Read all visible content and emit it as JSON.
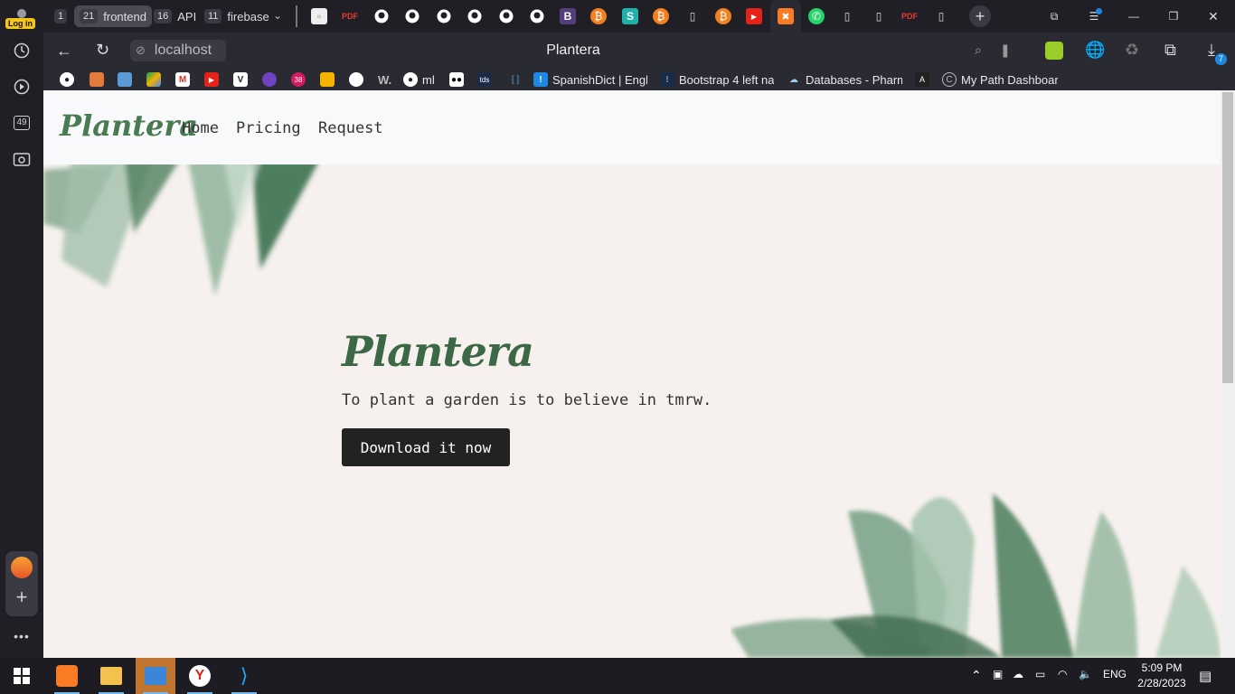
{
  "sidebar": {
    "login_label": "Log in",
    "badge_count": "49"
  },
  "tabstrip": {
    "workspaces": [
      {
        "num": "1",
        "label": ""
      },
      {
        "num": "21",
        "label": "frontend"
      },
      {
        "num": "16",
        "label": "API"
      },
      {
        "num": "11",
        "label": "firebase"
      }
    ],
    "new_tab": "+"
  },
  "addressbar": {
    "url": "localhost",
    "page_title": "Plantera",
    "downloads_badge": "7"
  },
  "bookmarks": [
    {
      "label": "ml",
      "icon": "github-icon"
    },
    {
      "label": "SpanishDict | Engli",
      "icon": "spanishdict-icon"
    },
    {
      "label": "Bootstrap 4 left na",
      "icon": "bootstrap-icon"
    },
    {
      "label": "Databases - Pharm",
      "icon": "cloud-icon"
    },
    {
      "label": "My Path Dashboar",
      "icon": "path-icon"
    }
  ],
  "bookmark_misc": {
    "youtube_badge": "38",
    "w_label": "W.",
    "tds_label": "tds"
  },
  "page": {
    "brand": "Plantera",
    "nav": [
      "Home",
      "Pricing",
      "Request"
    ],
    "hero_title": "Plantera",
    "hero_subtitle": "To plant a garden is to believe in tmrw.",
    "hero_button": "Download it now"
  },
  "taskbar": {
    "language": "ENG",
    "time": "5:09 PM",
    "date": "2/28/2023"
  },
  "colors": {
    "brand_green": "#3d6846",
    "page_bg": "#f6f1ee",
    "button_bg": "#222222"
  }
}
